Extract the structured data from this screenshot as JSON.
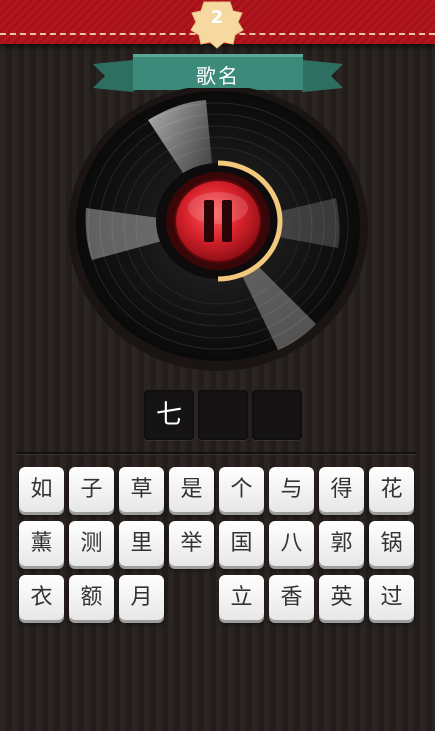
{
  "level": "2",
  "category": "歌名",
  "answer_slots": [
    "七",
    "",
    ""
  ],
  "keys": [
    [
      "如",
      "子",
      "草",
      "是",
      "个",
      "与",
      "得",
      "花"
    ],
    [
      "薰",
      "测",
      "里",
      "举",
      "国",
      "八",
      "郭",
      "锅"
    ],
    [
      "衣",
      "额",
      "月",
      "",
      "立",
      "香",
      "英",
      "过"
    ]
  ],
  "colors": {
    "header_red": "#b3161d",
    "ribbon_teal": "#3c8b7a",
    "play_red": "#d8222c",
    "progress_ring": "#f2c87c"
  },
  "icons": {
    "play_state": "pause-icon"
  }
}
